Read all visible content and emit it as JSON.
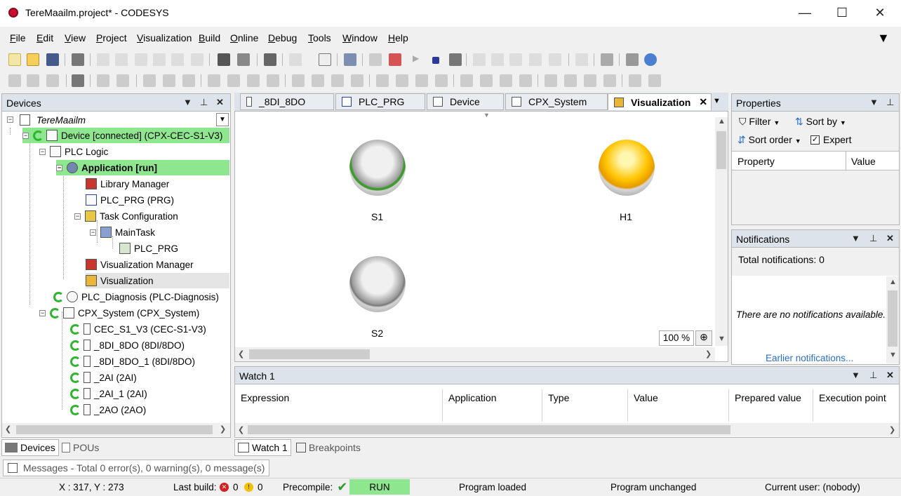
{
  "window": {
    "title": "TereMaailm.project* - CODESYS",
    "minimize": "—",
    "maximize": "☐",
    "close": "✕"
  },
  "menu": [
    "File",
    "Edit",
    "View",
    "Project",
    "Visualization",
    "Build",
    "Online",
    "Debug",
    "Tools",
    "Window",
    "Help"
  ],
  "devices_panel": {
    "title": "Devices",
    "root": "TereMaailm",
    "tree": [
      {
        "label": "Device [connected] (CPX-CEC-S1-V3)",
        "highlight": "green"
      },
      {
        "label": "PLC Logic"
      },
      {
        "label": "Application [run]",
        "highlight": "green"
      },
      {
        "label": "Library Manager"
      },
      {
        "label": "PLC_PRG (PRG)"
      },
      {
        "label": "Task Configuration"
      },
      {
        "label": "MainTask"
      },
      {
        "label": "PLC_PRG"
      },
      {
        "label": "Visualization Manager"
      },
      {
        "label": "Visualization",
        "highlight": "gray"
      },
      {
        "label": "PLC_Diagnosis (PLC-Diagnosis)"
      },
      {
        "label": "CPX_System (CPX_System)"
      },
      {
        "label": "CEC_S1_V3 (CEC-S1-V3)"
      },
      {
        "label": "_8DI_8DO (8DI/8DO)"
      },
      {
        "label": "_8DI_8DO_1 (8DI/8DO)"
      },
      {
        "label": "_2AI (2AI)"
      },
      {
        "label": "_2AI_1 (2AI)"
      },
      {
        "label": "_2AO (2AO)"
      }
    ],
    "bottom_tabs": [
      "Devices",
      "POUs"
    ]
  },
  "editor_tabs": [
    {
      "label": "_8DI_8DO"
    },
    {
      "label": "PLC_PRG"
    },
    {
      "label": "Device"
    },
    {
      "label": "CPX_System"
    },
    {
      "label": "Visualization",
      "active": true
    }
  ],
  "visualization": {
    "elements": [
      {
        "label": "S1",
        "kind": "button"
      },
      {
        "label": "H1",
        "kind": "lamp-on"
      },
      {
        "label": "S2",
        "kind": "button"
      }
    ],
    "zoom": "100 %"
  },
  "properties_panel": {
    "title": "Properties",
    "filter": "Filter",
    "sort_by": "Sort by",
    "sort_order": "Sort order",
    "expert": "Expert",
    "col_property": "Property",
    "col_value": "Value"
  },
  "notifications_panel": {
    "title": "Notifications",
    "total": "Total notifications: 0",
    "empty": "There are no notifications available.",
    "earlier": "Earlier notifications..."
  },
  "watch_panel": {
    "title": "Watch 1",
    "columns": [
      "Expression",
      "Application",
      "Type",
      "Value",
      "Prepared value",
      "Execution point"
    ],
    "bottom_tabs": [
      "Watch 1",
      "Breakpoints"
    ]
  },
  "messages": "Messages - Total 0 error(s), 0 warning(s), 0 message(s)",
  "status": {
    "coords": "X : 317, Y : 273",
    "last_build": "Last build:",
    "errors": "0",
    "warnings": "0",
    "precompile": "Precompile:",
    "run": "RUN",
    "program_loaded": "Program loaded",
    "program_unchanged": "Program unchanged",
    "current_user": "Current user: (nobody)"
  },
  "colors": {
    "run_green": "#8ee68e",
    "header_blue": "#dde3ea",
    "lamp_yellow": "#ffc400"
  }
}
